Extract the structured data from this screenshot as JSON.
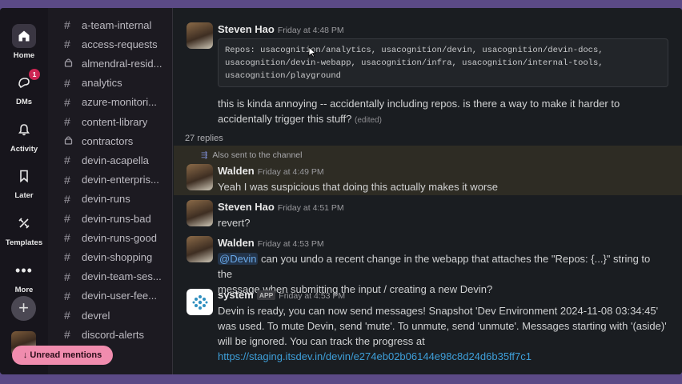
{
  "rail": {
    "items": [
      {
        "label": "Home",
        "icon": "home-icon"
      },
      {
        "label": "DMs",
        "icon": "dm-icon",
        "badge": "1"
      },
      {
        "label": "Activity",
        "icon": "bell-icon"
      },
      {
        "label": "Later",
        "icon": "bookmark-icon"
      },
      {
        "label": "Templates",
        "icon": "templates-icon"
      },
      {
        "label": "More",
        "icon": "more-icon"
      }
    ],
    "add": "+"
  },
  "channels": [
    {
      "name": "a-team-internal",
      "type": "hash"
    },
    {
      "name": "access-requests",
      "type": "hash"
    },
    {
      "name": "almendral-resid...",
      "type": "lock"
    },
    {
      "name": "analytics",
      "type": "hash"
    },
    {
      "name": "azure-monitori...",
      "type": "hash"
    },
    {
      "name": "content-library",
      "type": "hash"
    },
    {
      "name": "contractors",
      "type": "lock"
    },
    {
      "name": "devin-acapella",
      "type": "hash"
    },
    {
      "name": "devin-enterpris...",
      "type": "hash"
    },
    {
      "name": "devin-runs",
      "type": "hash"
    },
    {
      "name": "devin-runs-bad",
      "type": "hash"
    },
    {
      "name": "devin-runs-good",
      "type": "hash"
    },
    {
      "name": "devin-shopping",
      "type": "hash"
    },
    {
      "name": "devin-team-ses...",
      "type": "hash"
    },
    {
      "name": "devin-user-fee...",
      "type": "hash"
    },
    {
      "name": "devrel",
      "type": "hash"
    },
    {
      "name": "discord-alerts",
      "type": "hash"
    }
  ],
  "unread_mentions": "↓  Unread mentions",
  "thread": {
    "first": {
      "author": "Steven Hao",
      "time": "Friday at 4:48 PM",
      "code_lines": [
        "Repos: usacognition/analytics, usacognition/devin, usacognition/devin-docs,",
        "usacognition/devin-webapp, usacognition/infra, usacognition/internal-tools,",
        "usacognition/playground"
      ],
      "text_line1": "this is kinda annoying -- accidentally including repos. is there a way to make it harder to",
      "text_line2": "accidentally trigger this stuff?",
      "edited": "(edited)"
    },
    "replies": "27 replies",
    "also_sent": "Also sent to the channel",
    "messages": [
      {
        "author": "Walden",
        "time": "Friday at 4:49 PM",
        "text": "Yeah I was suspicious that doing this actually makes it worse"
      },
      {
        "author": "Steven Hao",
        "time": "Friday at 4:51 PM",
        "text": "revert?"
      },
      {
        "author": "Walden",
        "time": "Friday at 4:53 PM",
        "mention": "@Devin",
        "text_line1": " can you undo a recent change in the webapp that attaches the \"Repos: {...}\" string to the",
        "text_line2": "message when submitting the input / creating a new Devin?"
      },
      {
        "author": "system",
        "app_tag": "APP",
        "time": "Friday at 4:53 PM",
        "line1": "Devin is ready, you can now send messages! Snapshot 'Dev Environment 2024-11-08 03:34:45'",
        "line2": "was used. To mute Devin, send 'mute'. To unmute, send 'unmute'. Messages starting with '(aside)'",
        "line3": "will be ignored. You can track the progress at",
        "link": "https://staging.itsdev.in/devin/e274eb02b06144e98c8d24d6b35ff7c1"
      }
    ]
  },
  "colors": {
    "accent": "#5b4a86",
    "unread": "#f08cae",
    "badge": "#cd2553",
    "link": "#3e9fd9",
    "highlight": "#2e2c24"
  }
}
